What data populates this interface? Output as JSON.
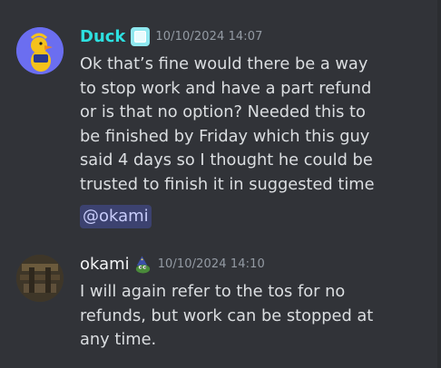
{
  "messages": [
    {
      "author": "Duck",
      "author_color": "#2de0e0",
      "badge_icon": "square-role-icon",
      "timestamp": "10/10/2024 14:07",
      "text": "Ok that’s fine would there be a way\nto stop work and have a part refund\nor is that no option? Needed this to\nbe finished by Friday which this guy\nsaid 4 days so I thought he could be\ntrusted to finish it in suggested time",
      "mention": "@okami"
    },
    {
      "author": "okami",
      "author_color": "#f2f3f5",
      "badge_icon": "pepe-wizard-icon",
      "timestamp": "10/10/2024 14:10",
      "text": "I will again refer to the tos for no\nrefunds, but work can be stopped at\nany time."
    }
  ]
}
